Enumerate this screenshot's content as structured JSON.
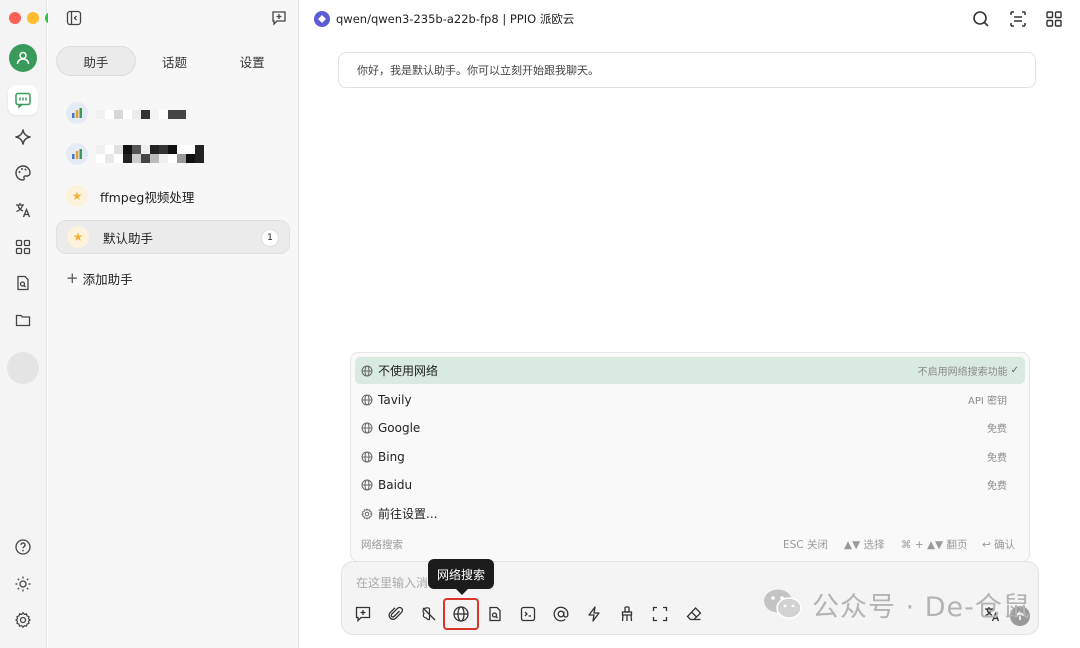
{
  "window": {
    "traffic_lights": {
      "close": "#fe5f57",
      "minimize": "#febc2e",
      "maximize": "#28c840"
    }
  },
  "header": {
    "model_name": "qwen/qwen3-235b-a22b-fp8 | PPIO 派欧云"
  },
  "rail": {
    "items": [
      {
        "icon": "chat-icon",
        "active": true
      },
      {
        "icon": "sparkle-icon"
      },
      {
        "icon": "palette-icon"
      },
      {
        "icon": "translate-icon"
      },
      {
        "icon": "apps-grid-icon"
      },
      {
        "icon": "file-search-icon"
      },
      {
        "icon": "folder-icon"
      }
    ],
    "bottom": [
      "help-icon",
      "sun-icon",
      "gear-icon"
    ]
  },
  "panel": {
    "tabs": [
      "助手",
      "话题",
      "设置"
    ],
    "active_tab": 0,
    "assistants": [
      {
        "name": "",
        "emoji": "chart",
        "redacted": true
      },
      {
        "name": "",
        "emoji": "chart",
        "redacted": true
      },
      {
        "name": "ffmpeg视频处理",
        "emoji": "star"
      },
      {
        "name": "默认助手",
        "emoji": "star",
        "badge": "1",
        "active": true
      }
    ],
    "add_assistant": "添加助手"
  },
  "chat": {
    "greeting": "你好，我是默认助手。你可以立刻开始跟我聊天。"
  },
  "dropdown": {
    "items": [
      {
        "label": "不使用网络",
        "note": "不启用网络搜索功能",
        "checked": true,
        "icon": "globe-icon"
      },
      {
        "label": "Tavily",
        "note": "API 密钥",
        "icon": "globe-icon"
      },
      {
        "label": "Google",
        "note": "免费",
        "icon": "globe-icon"
      },
      {
        "label": "Bing",
        "note": "免费",
        "icon": "globe-icon"
      },
      {
        "label": "Baidu",
        "note": "免费",
        "icon": "globe-icon"
      },
      {
        "label": "前往设置...",
        "note": "",
        "icon": "gear-icon"
      }
    ],
    "footer": {
      "title": "网络搜索",
      "esc": "ESC 关闭",
      "select": "▲▼ 选择",
      "page": "⌘ + ▲▼ 翻页",
      "confirm": "↩ 确认"
    }
  },
  "input": {
    "placeholder": "在这里输入消",
    "tooltip": "网络搜索",
    "tools": [
      "new-topic-icon",
      "paperclip-icon",
      "no-brain-icon",
      "globe-icon",
      "file-search-icon",
      "terminal-icon",
      "at-icon",
      "lightning-icon",
      "broom-icon",
      "expand-icon",
      "eraser-icon"
    ]
  },
  "watermark": {
    "text": "公众号 · De-仓鼠"
  },
  "colors": {
    "accent": "#3a9a5b",
    "highlight": "#d9ebe0",
    "selection_border": "#d9362a"
  }
}
